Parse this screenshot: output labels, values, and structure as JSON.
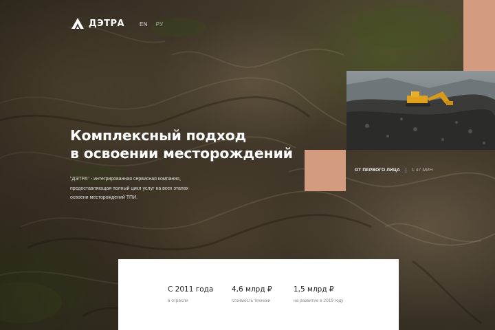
{
  "header": {
    "logo_text": "ДЭТРА",
    "logo_icon": "mountain-logo-icon",
    "languages": [
      {
        "label": "EN",
        "active": true
      },
      {
        "label": "РУ",
        "active": false
      }
    ]
  },
  "hero": {
    "title_line1": "Комплексный подход",
    "title_line2": "в освоении месторождений",
    "description": "\"ДЭТРА\" - интегрированная сервисная компания, предоставляющая полный цикл услуг на всех этапах освоени месторождений ТПИ."
  },
  "video": {
    "caption": "ОТ ПЕРВОГО ЛИЦА",
    "duration": "1:47 МИН",
    "thumbnail_icon": "excavator-photo"
  },
  "stats": [
    {
      "value": "С 2011 года",
      "label": "в отрасли"
    },
    {
      "value": "4,6 млрд ₽",
      "label": "стоимость техники"
    },
    {
      "value": "1,5 млрд ₽",
      "label": "на развитие в 2019 году"
    }
  ],
  "colors": {
    "accent": "#d49c7e",
    "panel": "#ffffff",
    "text_dark": "#1d1d1d",
    "text_muted": "#8a8a8a"
  }
}
